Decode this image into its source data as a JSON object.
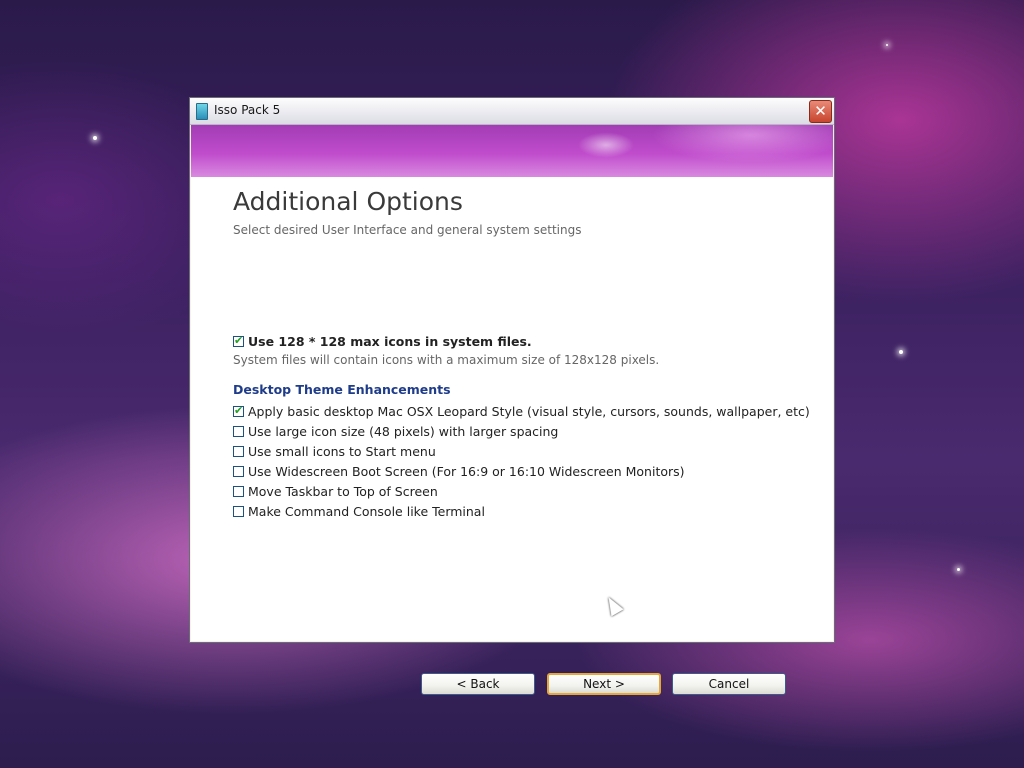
{
  "window": {
    "title": "Isso Pack 5"
  },
  "page": {
    "heading": "Additional Options",
    "subtitle": "Select desired User Interface and general system settings"
  },
  "main_option": {
    "label": "Use 128 * 128 max icons in system files.",
    "checked": true,
    "note": "System files will contain icons with a maximum size of 128x128 pixels."
  },
  "section": {
    "title": "Desktop Theme Enhancements",
    "options": [
      {
        "label": "Apply basic desktop Mac OSX Leopard Style (visual style, cursors, sounds, wallpaper, etc)",
        "checked": true
      },
      {
        "label": "Use large icon size (48 pixels) with larger spacing",
        "checked": false
      },
      {
        "label": "Use small icons to Start menu",
        "checked": false
      },
      {
        "label": "Use Widescreen Boot Screen (For 16:9 or 16:10 Widescreen Monitors)",
        "checked": false
      },
      {
        "label": "Move Taskbar to Top of Screen",
        "checked": false
      },
      {
        "label": "Make Command Console like Terminal",
        "checked": false
      }
    ]
  },
  "buttons": {
    "back": "< Back",
    "next": "Next >",
    "cancel": "Cancel"
  },
  "icons": {
    "close": "close-icon",
    "app": "app-icon",
    "cursor": "mouse-cursor-icon"
  }
}
